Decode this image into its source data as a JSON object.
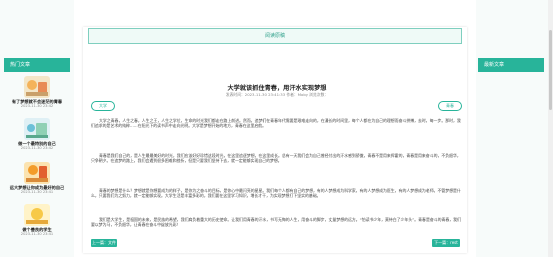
{
  "left_sidebar": {
    "header": "热门文章",
    "items": [
      {
        "title": "有了梦想就不会迷茫的青春",
        "date": "2023-11-30 23:42"
      },
      {
        "title": "做一个最特别的自己",
        "date": "2023-11-30 23:42"
      },
      {
        "title": "远大梦想让你成为最好的自己",
        "date": "2023-11-30 23:41"
      },
      {
        "title": "做个善良的学生",
        "date": "2023-11-30 23:41"
      }
    ]
  },
  "topbar": {
    "label": "阅读原稿"
  },
  "article": {
    "title": "大学就该抓住青春，用汗水实现梦想",
    "meta": "发表时间：2023-11-30 23:41:33   作者：Moby   浏览次数：",
    "tag_left": "大学",
    "tag_right": "青春",
    "paragraphs": [
      "大学之青春，人生之春，人生之王，人生之学位，生命的时光我们都走在路上前进。然而，追梦们在青春年代需要是艰难走向的，在漫长的时间里，每个人都在为自己的理想而奋斗拼搏，去时，每一步。那时，我们追求的是艺术的纯粹……在阳光下的读书声中走向光明。大学是梦想开始的地方，青春在这里启航。",
      "青春是我们自己的，是人生最最美好的时光，我们应该好好珍惜这段时光，在这里追逐梦想，在这里成长。总有一天我们会为自己曾经付出的汗水感到骄傲，青春不是用来挥霍的，青春是用来奋斗的，不负韶华，只争朝夕。在追梦的路上，我们会遇到很多困难和挫折，但是只要我们坚持下去，就一定能够实现自己的梦想。",
      "青春的梦想是什么？梦想就是你想要成为的样子，是你为之奋斗的目标，是你心中最闪亮的星星。我们每个人都有自己的梦想，有的人梦想成为科学家，有的人梦想成为医生，有的人梦想成为老师。不管梦想是什么，只要我们为之努力，就一定能够实现。大学生活是丰富多彩的，我们要在这里学习知识，增长才干，为实现梦想打下坚实的基础。",
      "我们是大学生，是祖国的未来，是民族的希望，我们肩负着重大的历史使命。让我们用青春的汗水，书写无悔的人生，用奋斗的脚步，丈量梦想的远方。“怕读书少年，莫待白了少年头”。青春是奋斗的青春，我们要以梦为马，不负韶华，让青春在奋斗中绽放光彩！"
    ]
  },
  "nav": {
    "prev": "上一篇：文件",
    "next": "下一篇：rest"
  },
  "right_sidebar": {
    "header": "最新文章"
  }
}
